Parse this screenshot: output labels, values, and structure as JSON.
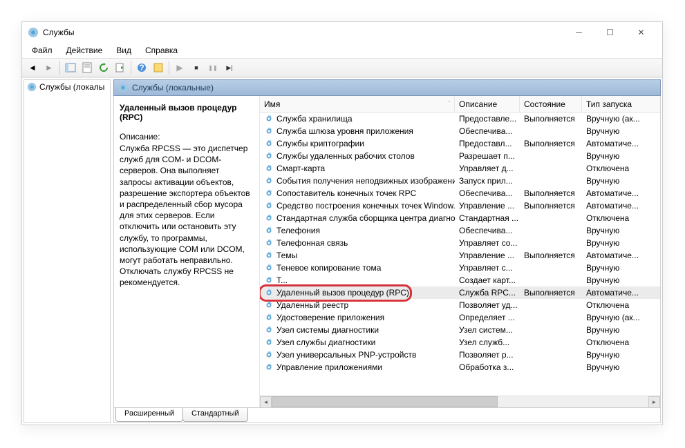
{
  "window": {
    "title": "Службы"
  },
  "menubar": [
    "Файл",
    "Действие",
    "Вид",
    "Справка"
  ],
  "leftpane": {
    "node": "Службы (локалы"
  },
  "rightHeader": "Службы (локальные)",
  "details": {
    "serviceName": "Удаленный вызов процедур (RPC)",
    "descLabel": "Описание:",
    "descBody": "Служба RPCSS — это диспетчер служб для COM- и DCOM-серверов. Она выполняет запросы активации объектов, разрешение экспортера объектов и распределенный сбор мусора для этих серверов. Если отключить или остановить эту службу, то программы, использующие COM или DCOM, могут работать неправильно. Отключать службу RPCSS не рекомендуется."
  },
  "columns": {
    "name": "Имя",
    "desc": "Описание",
    "state": "Состояние",
    "start": "Тип запуска"
  },
  "tabs": {
    "extended": "Расширенный",
    "standard": "Стандартный"
  },
  "services": [
    {
      "name": "Служба хранилища",
      "desc": "Предоставле...",
      "state": "Выполняется",
      "start": "Вручную (ак..."
    },
    {
      "name": "Служба шлюза уровня приложения",
      "desc": "Обеспечива...",
      "state": "",
      "start": "Вручную"
    },
    {
      "name": "Службы криптографии",
      "desc": "Предоставл...",
      "state": "Выполняется",
      "start": "Автоматиче..."
    },
    {
      "name": "Службы удаленных рабочих столов",
      "desc": "Разрешает п...",
      "state": "",
      "start": "Вручную"
    },
    {
      "name": "Смарт-карта",
      "desc": "Управляет д...",
      "state": "",
      "start": "Отключена"
    },
    {
      "name": "События получения неподвижных изображений",
      "desc": "Запуск прил...",
      "state": "",
      "start": "Вручную"
    },
    {
      "name": "Сопоставитель конечных точек RPC",
      "desc": "Обеспечива...",
      "state": "Выполняется",
      "start": "Автоматиче..."
    },
    {
      "name": "Средство построения конечных точек Window...",
      "desc": "Управление ...",
      "state": "Выполняется",
      "start": "Автоматиче..."
    },
    {
      "name": "Стандартная служба сборщика центра диагнос...",
      "desc": "Стандартная ...",
      "state": "",
      "start": "Отключена"
    },
    {
      "name": "Телефония",
      "desc": "Обеспечива...",
      "state": "",
      "start": "Вручную"
    },
    {
      "name": "Телефонная связь",
      "desc": "Управляет со...",
      "state": "",
      "start": "Вручную"
    },
    {
      "name": "Темы",
      "desc": "Управление ...",
      "state": "Выполняется",
      "start": "Автоматиче..."
    },
    {
      "name": "Теневое копирование тома",
      "desc": "Управляет с...",
      "state": "",
      "start": "Вручную"
    },
    {
      "name": "Т...",
      "desc": "Создает карт...",
      "state": "",
      "start": "Вручную"
    },
    {
      "name": "Удаленный вызов процедур (RPC)",
      "desc": "Служба RPC...",
      "state": "Выполняется",
      "start": "Автоматиче...",
      "selected": true
    },
    {
      "name": "Удаленный реестр",
      "desc": "Позволяет уд...",
      "state": "",
      "start": "Отключена"
    },
    {
      "name": "Удостоверение приложения",
      "desc": "Определяет ...",
      "state": "",
      "start": "Вручную (ак..."
    },
    {
      "name": "Узел системы диагностики",
      "desc": "Узел систем...",
      "state": "",
      "start": "Вручную"
    },
    {
      "name": "Узел службы диагностики",
      "desc": "Узел служб...",
      "state": "",
      "start": "Отключена"
    },
    {
      "name": "Узел универсальных PNP-устройств",
      "desc": "Позволяет р...",
      "state": "",
      "start": "Вручную"
    },
    {
      "name": "Управление приложениями",
      "desc": "Обработка з...",
      "state": "",
      "start": "Вручную"
    }
  ],
  "highlightIndex": 14,
  "icons": {
    "back": "◄",
    "fwd": "►",
    "up": "▲",
    "play": "▶",
    "stop": "■",
    "pause": "❚❚",
    "restart": "▶▶",
    "sort": "ˆ"
  }
}
